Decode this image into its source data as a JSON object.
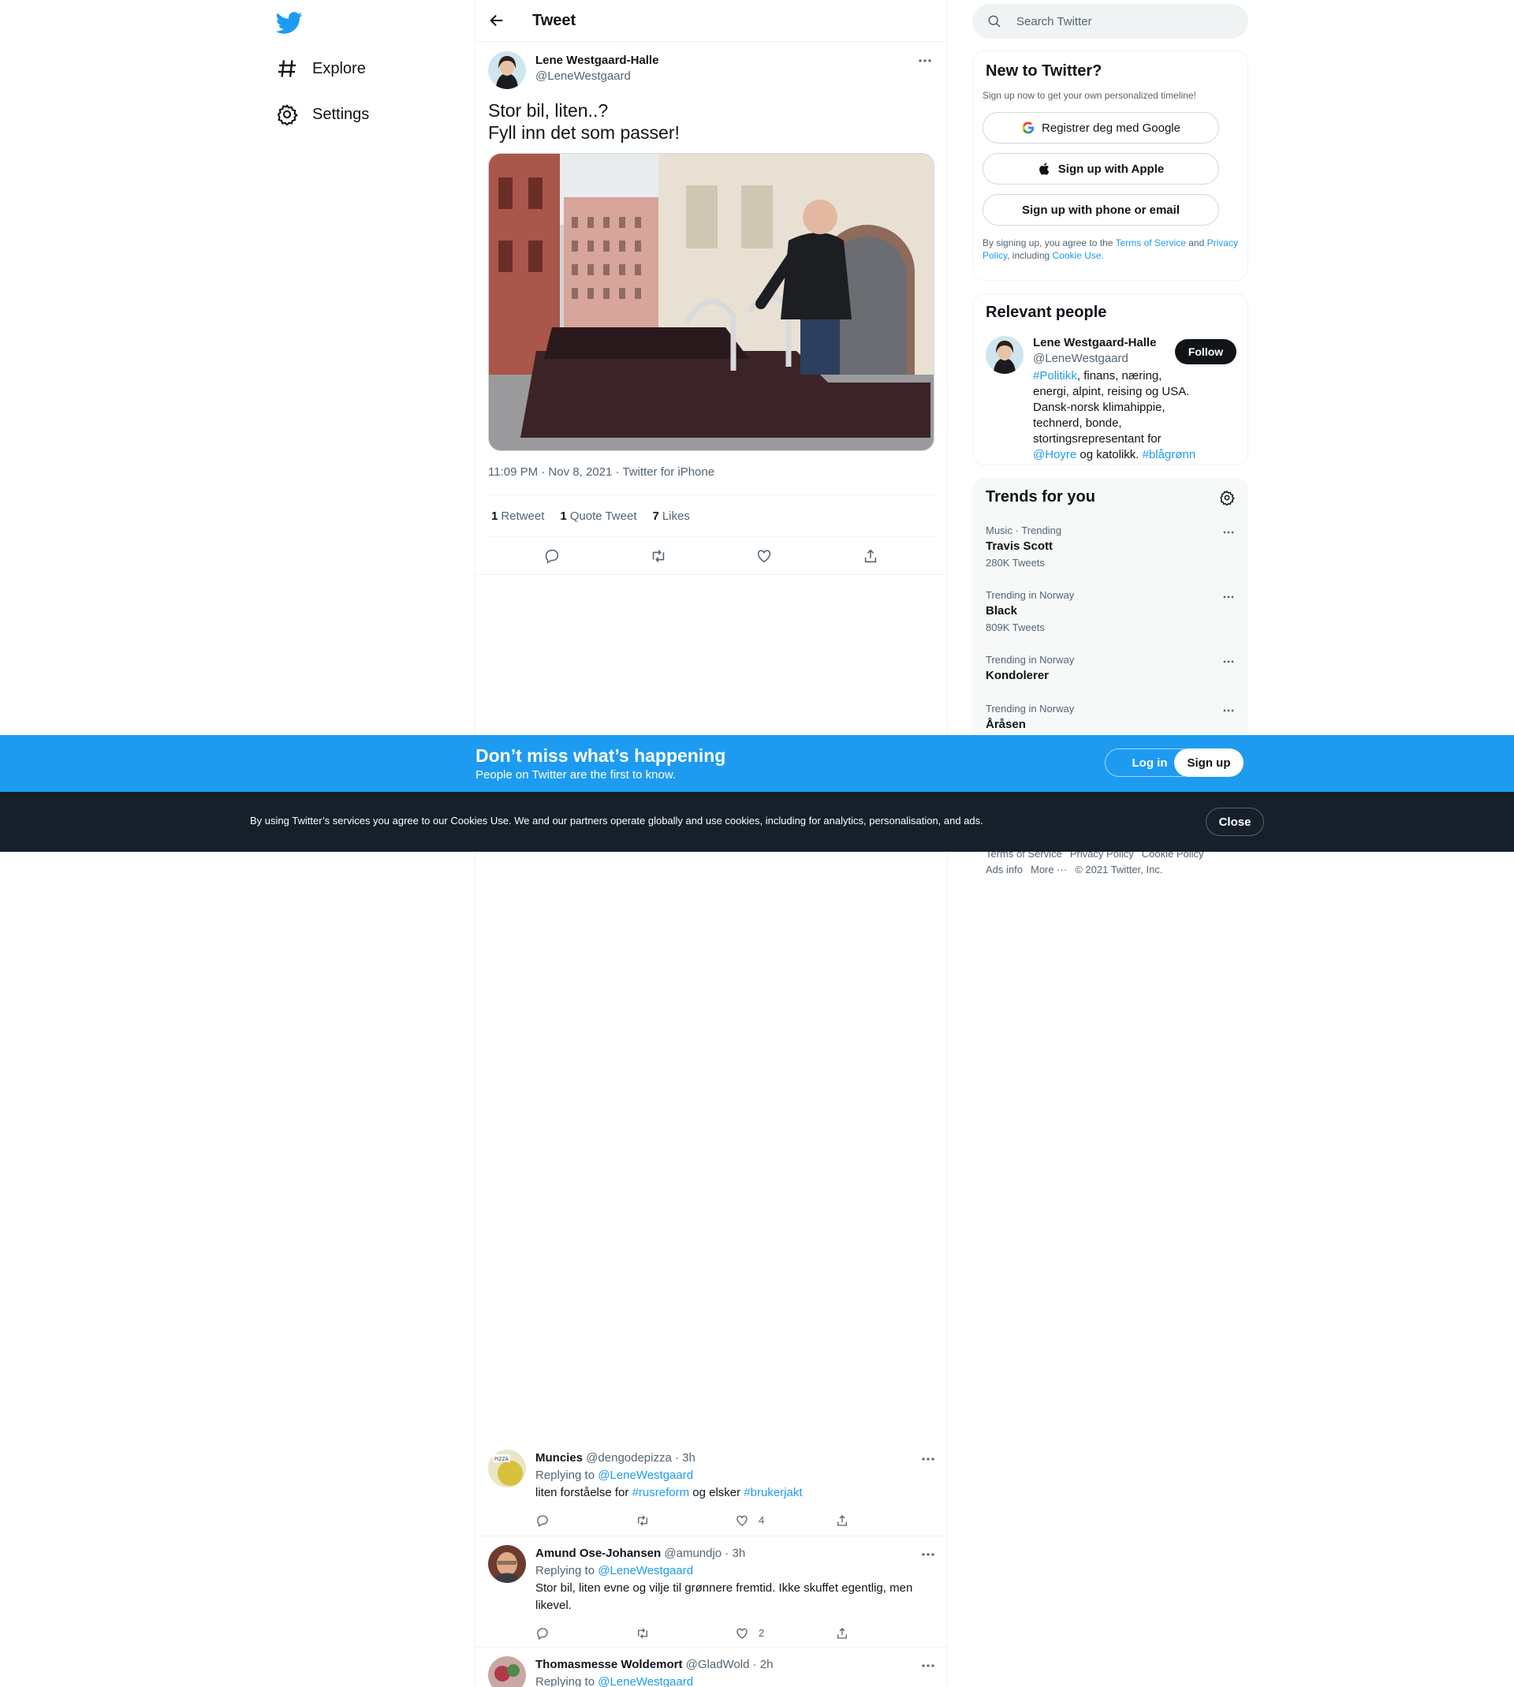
{
  "nav": {
    "explore_label": "Explore",
    "settings_label": "Settings"
  },
  "header": {
    "title": "Tweet"
  },
  "tweet": {
    "display_name": "Lene Westgaard-Halle",
    "handle": "@LeneWestgaard",
    "text_line1": "Stor bil, liten..?",
    "text_line2": "Fyll inn det som passer!",
    "meta": "11:09 PM · Nov 8, 2021 · Twitter for iPhone",
    "stats": [
      {
        "count": "1",
        "label": "Retweet"
      },
      {
        "count": "1",
        "label": "Quote Tweet"
      },
      {
        "count": "7",
        "label": "Likes"
      }
    ]
  },
  "replies": [
    {
      "name": "Muncies",
      "handle_time": "@dengodepizza · 3h",
      "replying_prefix": "Replying to",
      "replying_to": "@LeneWestgaard",
      "text_parts": [
        "liten forståelse for ",
        "#rusreform",
        " og elsker ",
        "#brukerjakt"
      ],
      "likes": "4"
    },
    {
      "name": "Amund Ose-Johansen",
      "handle_time": "@amundjo · 3h",
      "replying_prefix": "Replying to",
      "replying_to": "@LeneWestgaard",
      "text": "Stor bil, liten evne og vilje til grønnere fremtid. Ikke skuffet egentlig, men likevel.",
      "likes": "2"
    },
    {
      "name": "Thomasmesse Woldemort",
      "handle_time": "@GladWold · 2h",
      "replying_prefix": "Replying to",
      "replying_to": "@LeneWestgaard"
    }
  ],
  "search": {
    "placeholder": "Search Twitter"
  },
  "new_to_twitter": {
    "title": "New to Twitter?",
    "subtitle": "Sign up now to get your own personalized timeline!",
    "google_label": "Registrer deg med Google",
    "apple_label": "Sign up with Apple",
    "phone_label": "Sign up with phone or email",
    "legal_1": "By signing up, you agree to the ",
    "terms": "Terms of Service",
    "legal_2": " and ",
    "privacy": "Privacy Policy",
    "legal_3": ", including ",
    "cookie": "Cookie Use."
  },
  "relevant_people": {
    "title": "Relevant people",
    "name": "Lene Westgaard-Halle",
    "handle": "@LeneWestgaard",
    "follow_label": "Follow",
    "bio_tag1": "#Politikk",
    "bio_1": ", finans, næring, energi, alpint, reising og USA. Dansk-norsk klimahippie, technerd, bonde, stortingsrepresentant for ",
    "bio_mention": "@Hoyre",
    "bio_2": " og katolikk. ",
    "bio_tag2": "#blågrønn"
  },
  "trends": {
    "title": "Trends for you",
    "items": [
      {
        "context": "Music · Trending",
        "name": "Travis Scott",
        "count": "280K Tweets"
      },
      {
        "context": "Trending in Norway",
        "name": "Black",
        "count": "809K Tweets"
      },
      {
        "context": "Trending in Norway",
        "name": "Kondolerer",
        "count": ""
      },
      {
        "context": "Trending in Norway",
        "name": "Åråsen",
        "count": ""
      }
    ]
  },
  "footer": {
    "terms": "Terms of Service",
    "privacy": "Privacy Policy",
    "cookie": "Cookie Policy",
    "ads": "Ads info",
    "more": "More ···",
    "copyright": "© 2021 Twitter, Inc."
  },
  "signup_bar": {
    "title": "Don’t miss what’s happening",
    "subtitle": "People on Twitter are the first to know.",
    "login_label": "Log in",
    "signup_label": "Sign up"
  },
  "cookie_bar": {
    "text": "By using Twitter’s services you agree to our Cookies Use. We and our partners operate globally and use cookies, including for analytics, personalisation, and ads.",
    "close_label": "Close"
  },
  "colors": {
    "accent": "#1d9bf0",
    "text": "#0f1419",
    "secondary": "#536471",
    "cookie_bg": "#15202b"
  }
}
